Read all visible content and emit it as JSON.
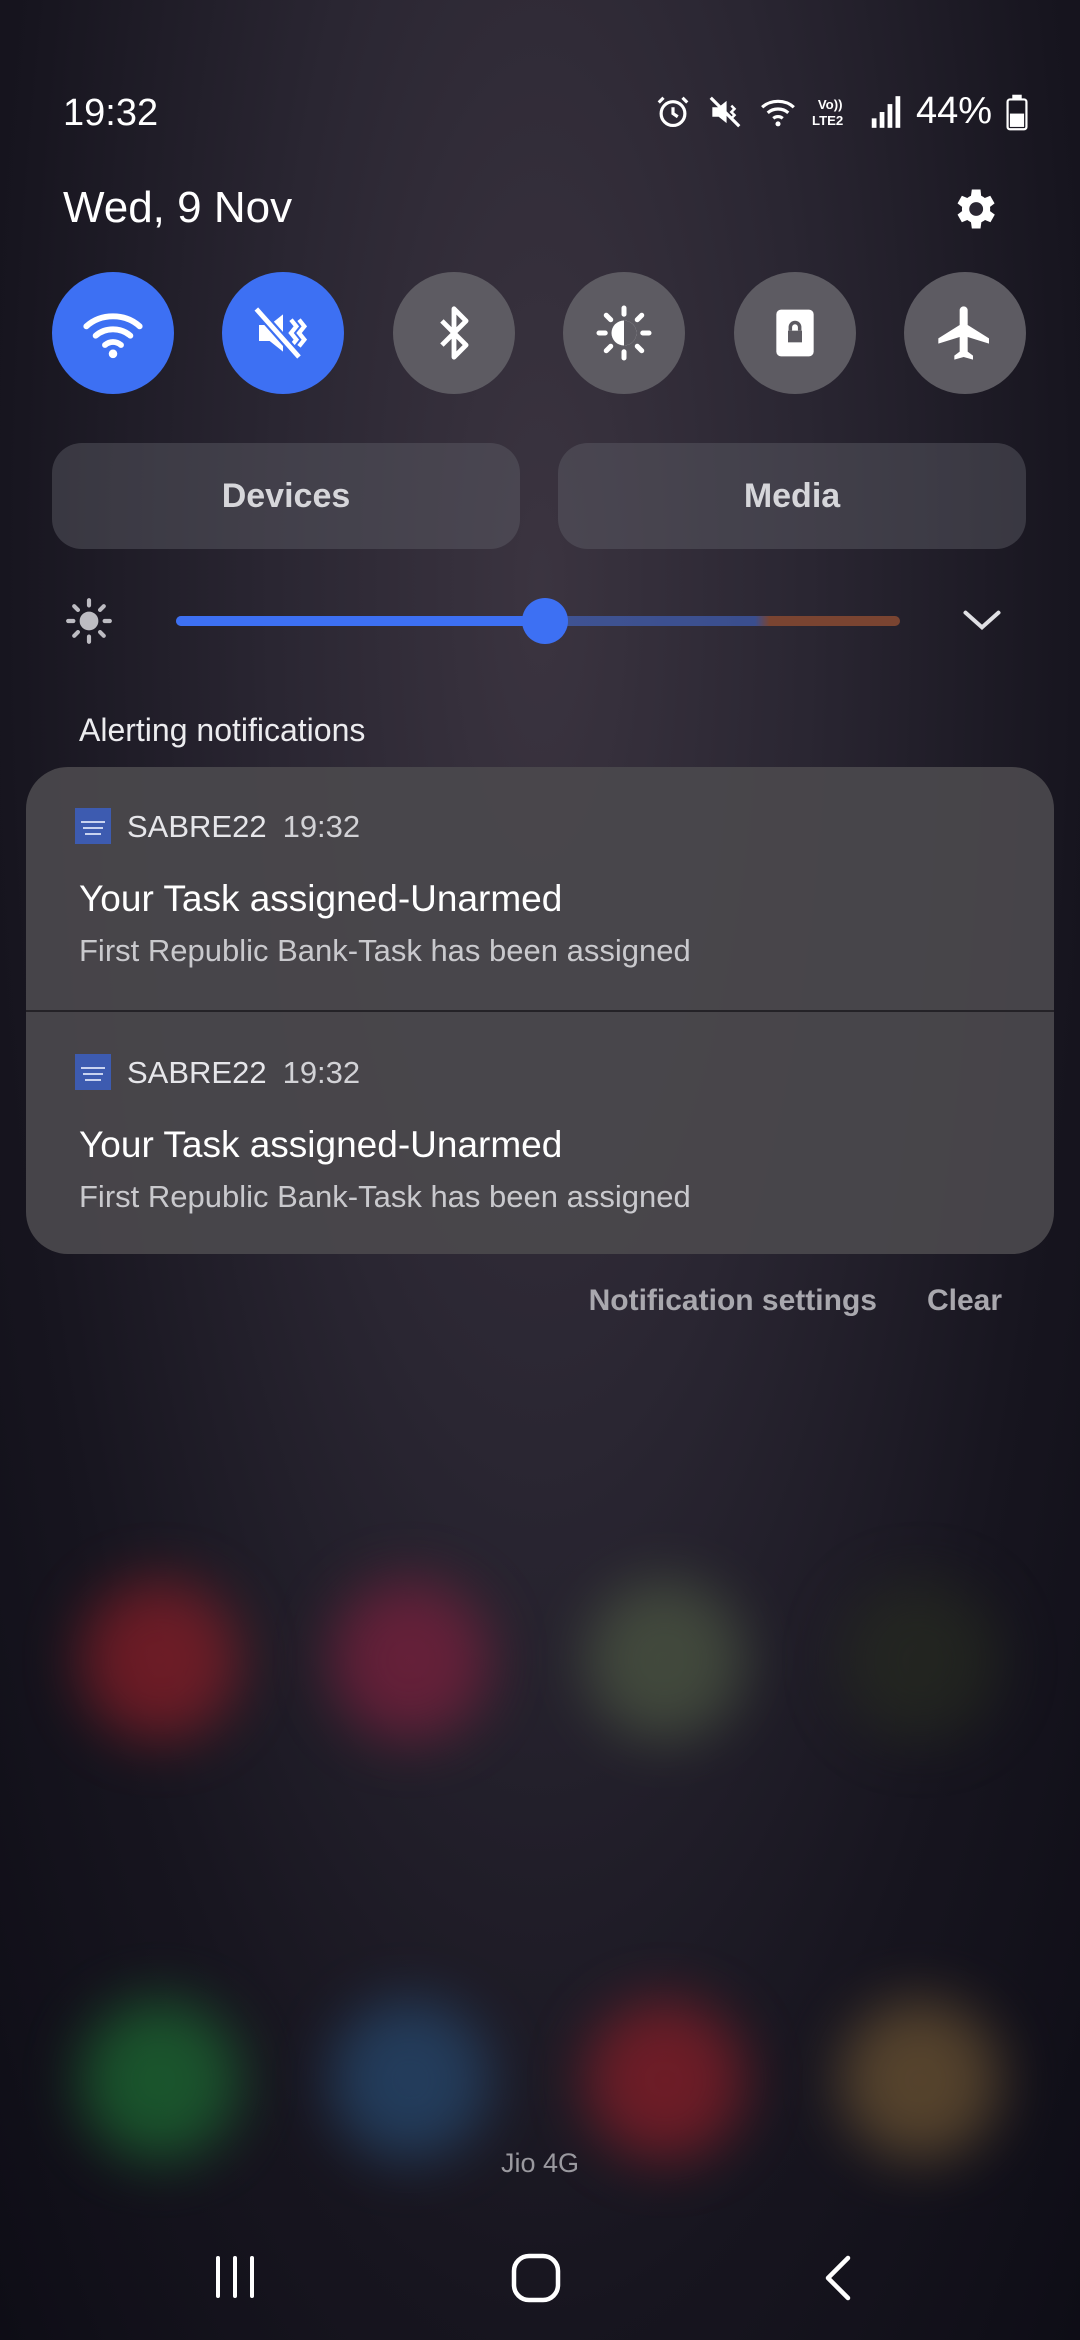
{
  "status_bar": {
    "time": "19:32",
    "battery": "44%",
    "icons": [
      "alarm-icon",
      "mute-icon",
      "wifi-icon",
      "volte-icon",
      "signal-icon",
      "battery-icon"
    ]
  },
  "header": {
    "date": "Wed, 9 Nov"
  },
  "quick_settings": [
    {
      "name": "wifi",
      "icon": "wifi-icon",
      "active": true
    },
    {
      "name": "sound",
      "icon": "mute-icon",
      "active": true
    },
    {
      "name": "bluetooth",
      "icon": "bluetooth-icon",
      "active": false
    },
    {
      "name": "auto-brightness",
      "icon": "brightness-icon",
      "active": false
    },
    {
      "name": "rotation-lock",
      "icon": "lock-icon",
      "active": false
    },
    {
      "name": "airplane",
      "icon": "airplane-icon",
      "active": false
    }
  ],
  "pills": {
    "devices": "Devices",
    "media": "Media"
  },
  "brightness": {
    "level": 0.51
  },
  "notifications": {
    "section_label": "Alerting notifications",
    "items": [
      {
        "app": "SABRE22",
        "time": "19:32",
        "title": "Your Task assigned-Unarmed",
        "body": "First Republic Bank-Task has been assigned"
      },
      {
        "app": "SABRE22",
        "time": "19:32",
        "title": "Your Task assigned-Unarmed",
        "body": "First Republic Bank-Task has been assigned"
      }
    ],
    "settings_label": "Notification settings",
    "clear_label": "Clear"
  },
  "carrier": "Jio 4G",
  "colors": {
    "accent": "#3d70f3",
    "tile_off": "#5d5b62",
    "card": "#4a484c"
  }
}
